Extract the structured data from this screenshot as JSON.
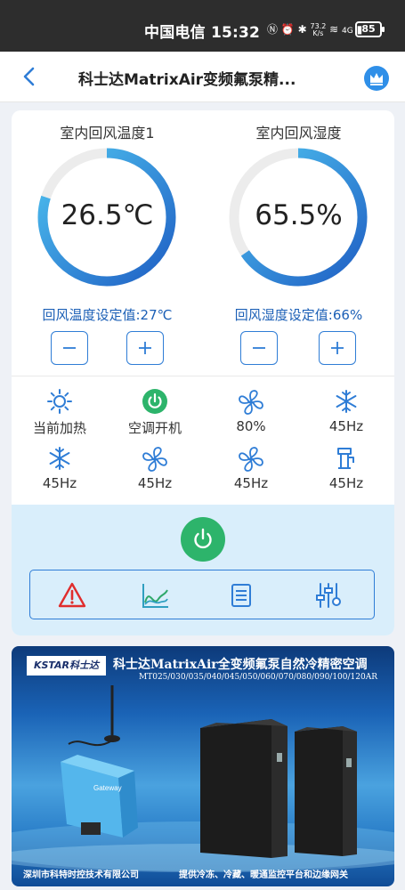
{
  "status_bar": {
    "carrier": "中国电信",
    "time": "15:32",
    "net_speed_value": "73.2",
    "net_speed_unit": "K/s",
    "signal_label": "4G",
    "battery": "85"
  },
  "header": {
    "title": "科士达MatrixAir变频氟泵精...",
    "back_icon": "chevron-left-icon",
    "menu_icon": "crown-icon"
  },
  "gauges": [
    {
      "title": "室内回风温度1",
      "value": "26.5℃",
      "fill_fraction": 0.8,
      "setpoint_label": "回风温度设定值:27℃",
      "minus": "−",
      "plus": "+"
    },
    {
      "title": "室内回风湿度",
      "value": "65.5%",
      "fill_fraction": 0.655,
      "setpoint_label": "回风湿度设定值:66%",
      "minus": "−",
      "plus": "+"
    }
  ],
  "status_items": [
    {
      "icon": "sun-icon",
      "label": "当前加热"
    },
    {
      "icon": "power-on-icon",
      "label": "空调开机"
    },
    {
      "icon": "fan-icon",
      "label": "80%"
    },
    {
      "icon": "snowflake-icon",
      "label": "45Hz"
    },
    {
      "icon": "snowflake-icon",
      "label": "45Hz"
    },
    {
      "icon": "fan-icon",
      "label": "45Hz"
    },
    {
      "icon": "fan-icon",
      "label": "45Hz"
    },
    {
      "icon": "pump-icon",
      "label": "45Hz"
    }
  ],
  "controls": {
    "power_icon": "power-icon",
    "toolbar": [
      "alarm-icon",
      "trend-chart-icon",
      "list-icon",
      "settings-sliders-icon"
    ]
  },
  "banner": {
    "logo": "KSTAR科士达",
    "headline": "科士达MatrixAir全变频氟泵自然冷精密空调",
    "models": "MT025/030/035/040/045/050/060/070/080/090/100/120AR",
    "device_label": "Gateway",
    "footer_left": "深圳市科特时控技术有限公司",
    "footer_right": "提供冷冻、冷藏、暖通监控平台和边缘网关"
  },
  "colors": {
    "accent": "#2f7dd6",
    "gauge_start": "#1f5fc4",
    "gauge_end": "#4fc3f0",
    "gauge_track": "#ececec",
    "power_green": "#2db46b",
    "alarm_red": "#e02d2d",
    "control_bg": "#d9eefb"
  }
}
